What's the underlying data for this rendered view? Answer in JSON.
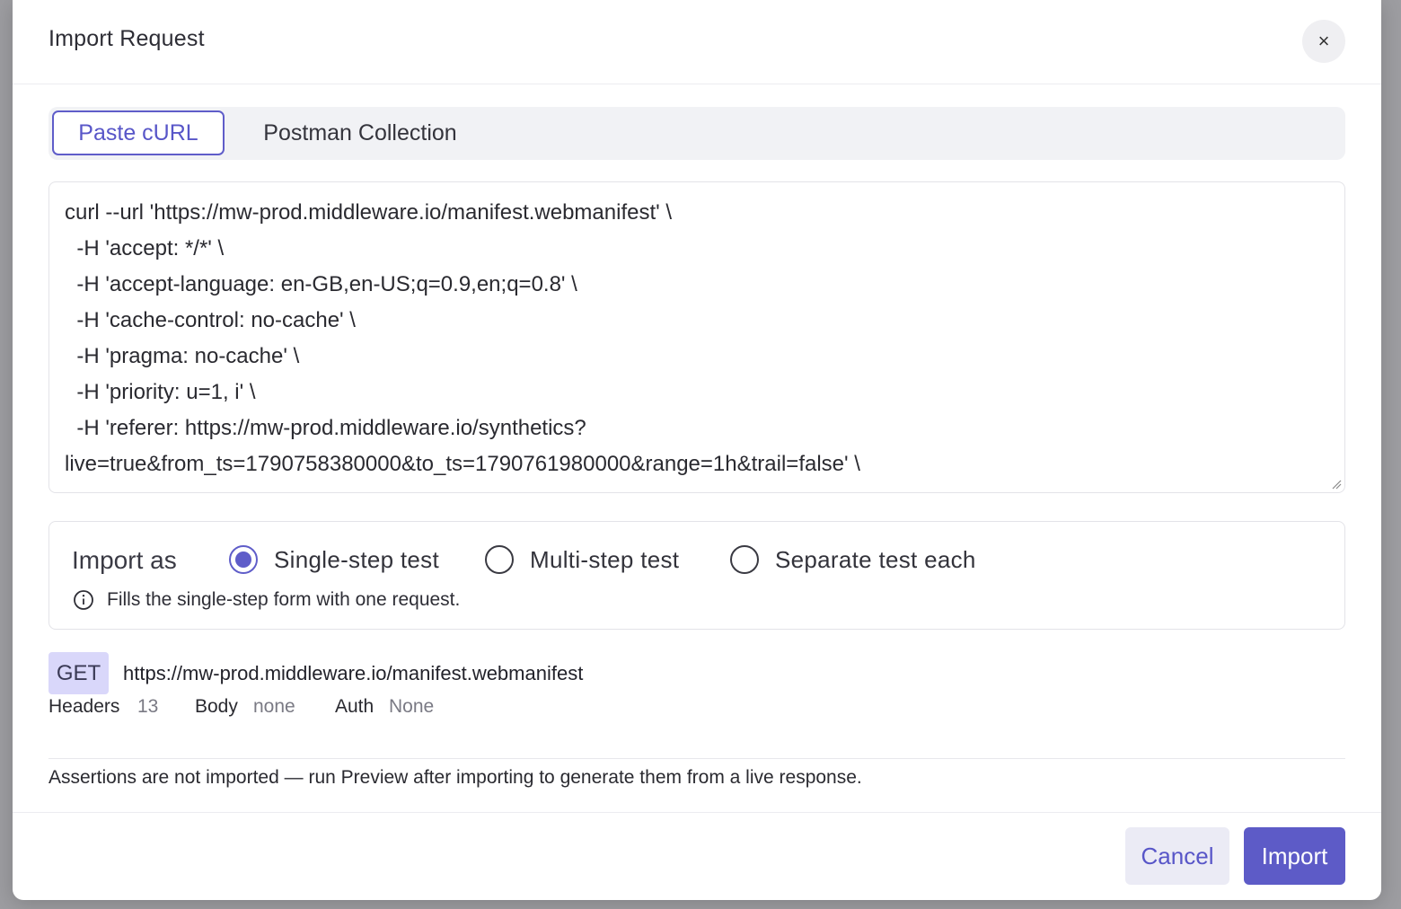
{
  "dialog": {
    "title": "Import Request",
    "close_glyph": "×"
  },
  "tabs": [
    {
      "label": "Paste cURL",
      "active": true
    },
    {
      "label": "Postman Collection",
      "active": false
    }
  ],
  "curl_input": {
    "value": "curl --url 'https://mw-prod.middleware.io/manifest.webmanifest' \\\n  -H 'accept: */*' \\\n  -H 'accept-language: en-GB,en-US;q=0.9,en;q=0.8' \\\n  -H 'cache-control: no-cache' \\\n  -H 'pragma: no-cache' \\\n  -H 'priority: u=1, i' \\\n  -H 'referer: https://mw-prod.middleware.io/synthetics?\nlive=true&from_ts=1790758380000&to_ts=1790761980000&range=1h&trail=false' \\"
  },
  "import_as": {
    "label": "Import as",
    "options": [
      {
        "label": "Single-step test",
        "checked": true
      },
      {
        "label": "Multi-step test",
        "checked": false
      },
      {
        "label": "Separate test each",
        "checked": false
      }
    ],
    "hint": "Fills the single-step form with one request.",
    "hint_icon": "info-icon"
  },
  "request_preview": {
    "method": "GET",
    "url": "https://mw-prod.middleware.io/manifest.webmanifest",
    "headers_label": "Headers",
    "headers_count": "13",
    "body_label": "Body",
    "body_value": "none",
    "auth_label": "Auth",
    "auth_value": "None"
  },
  "note": "Assertions are not imported — run Preview after importing to generate them from a live response.",
  "footer": {
    "cancel_label": "Cancel",
    "import_label": "Import"
  },
  "colors": {
    "accent": "#5d5bc7",
    "badge_bg": "#d9d7fa",
    "cancel_bg": "#ebebf5"
  }
}
